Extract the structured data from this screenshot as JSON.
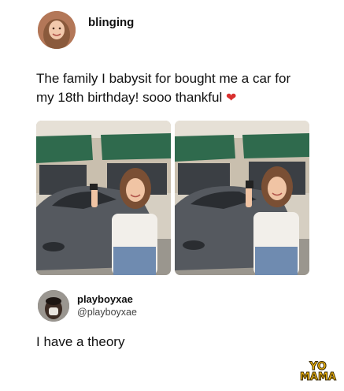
{
  "post1": {
    "username": "blinging",
    "text": "The family I babysit for bought me a car for my 18th birthday! sooo thankful",
    "heart": "❤"
  },
  "post2": {
    "username": "playboyxae",
    "handle": "@playboyxae",
    "text": "I have a theory"
  },
  "watermark": {
    "line1": "YO",
    "line2": "MAMA"
  },
  "colors": {
    "awning": "#2f6a4d",
    "car": "#55595f",
    "accent_heart": "#d9302f",
    "watermark": "#f5b80c"
  }
}
